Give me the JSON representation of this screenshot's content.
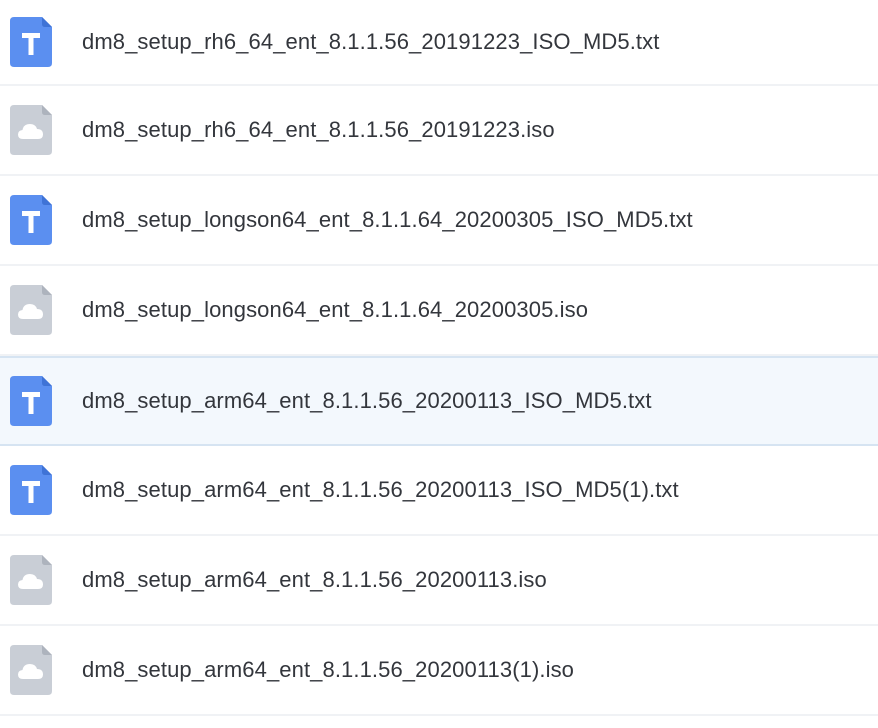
{
  "colors": {
    "text_icon_bg": "#5b8ff0",
    "iso_icon_bg": "#c9ced6",
    "selected_row_bg": "#f3f8fd",
    "filename_text": "#33363c"
  },
  "files": [
    {
      "name": "dm8_setup_rh6_64_ent_8.1.1.56_20191223_ISO_MD5.txt",
      "icon": "text-file-icon",
      "selected": false
    },
    {
      "name": "dm8_setup_rh6_64_ent_8.1.1.56_20191223.iso",
      "icon": "iso-cloud-file-icon",
      "selected": false
    },
    {
      "name": "dm8_setup_longson64_ent_8.1.1.64_20200305_ISO_MD5.txt",
      "icon": "text-file-icon",
      "selected": false
    },
    {
      "name": "dm8_setup_longson64_ent_8.1.1.64_20200305.iso",
      "icon": "iso-cloud-file-icon",
      "selected": false
    },
    {
      "name": "dm8_setup_arm64_ent_8.1.1.56_20200113_ISO_MD5.txt",
      "icon": "text-file-icon",
      "selected": true
    },
    {
      "name": "dm8_setup_arm64_ent_8.1.1.56_20200113_ISO_MD5(1).txt",
      "icon": "text-file-icon",
      "selected": false
    },
    {
      "name": "dm8_setup_arm64_ent_8.1.1.56_20200113.iso",
      "icon": "iso-cloud-file-icon",
      "selected": false
    },
    {
      "name": "dm8_setup_arm64_ent_8.1.1.56_20200113(1).iso",
      "icon": "iso-cloud-file-icon",
      "selected": false
    }
  ]
}
